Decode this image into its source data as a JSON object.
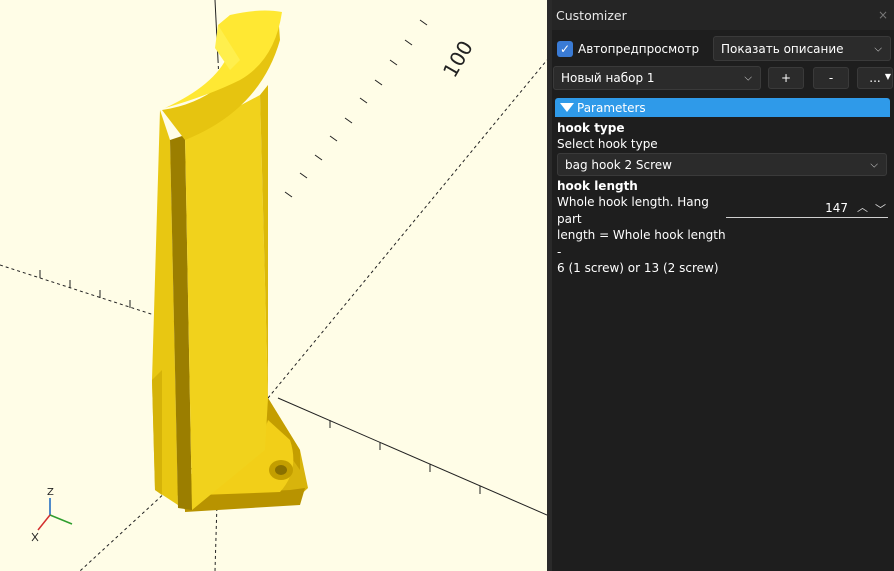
{
  "viewport": {
    "axis_label": "100",
    "axis_z_label": "Z",
    "colors": {
      "background": "#fffde7",
      "model_light": "#ffe833",
      "model_mid": "#f5d31a",
      "model_dark": "#c9a300",
      "model_shadow": "#8a7200"
    }
  },
  "customizer": {
    "title": "Customizer",
    "close_glyph": "×",
    "auto_preview": {
      "checked": true,
      "check_glyph": "✓",
      "label": "Автопредпросмотр"
    },
    "description_mode": {
      "value": "Показать описание"
    },
    "preset": {
      "value": "Новый набор 1"
    },
    "add_label": "+",
    "remove_label": "-",
    "more_label": "...",
    "chevron_glyph": "⌵",
    "section": {
      "label": "Parameters"
    },
    "params": [
      {
        "name": "hook type",
        "description": "Select hook type",
        "value": "bag hook 2 Screw"
      },
      {
        "name": "hook length",
        "description_lines": [
          "Whole hook length.  Hang part",
          "length = Whole hook length -",
          "6 (1 screw) or 13 (2 screw)"
        ],
        "value": "147"
      }
    ],
    "accent_color": "#2f9ae9"
  }
}
